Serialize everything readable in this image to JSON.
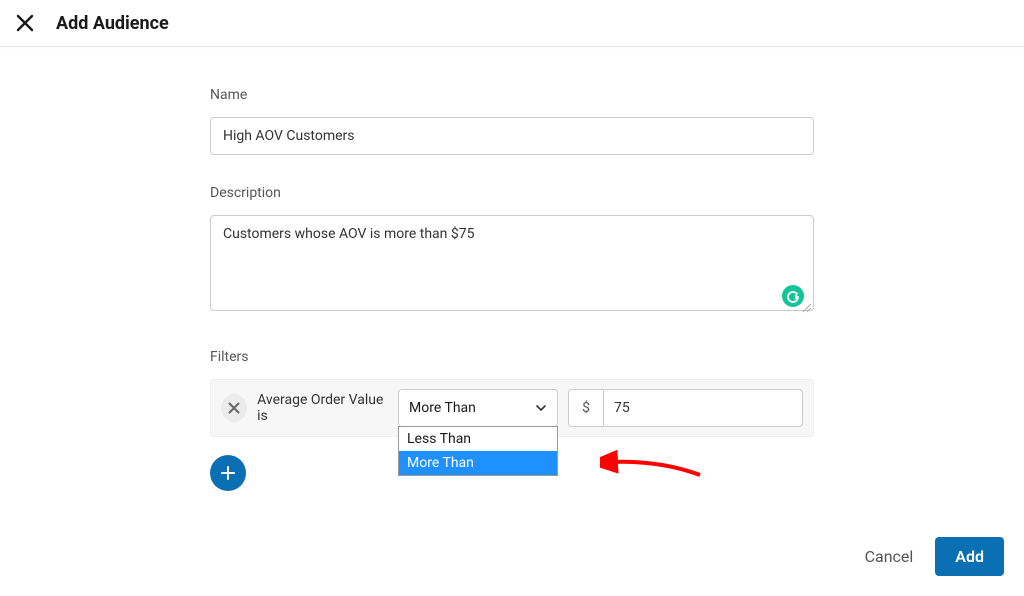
{
  "header": {
    "title": "Add Audience"
  },
  "form": {
    "name_label": "Name",
    "name_value": "High AOV Customers",
    "description_label": "Description",
    "description_value": "Customers whose AOV is more than $75",
    "filters_label": "Filters"
  },
  "filter": {
    "label": "Average Order Value is",
    "operator_selected": "More Than",
    "currency_symbol": "$",
    "value": "75",
    "options": [
      "Less Than",
      "More Than"
    ]
  },
  "footer": {
    "cancel_label": "Cancel",
    "add_label": "Add"
  }
}
